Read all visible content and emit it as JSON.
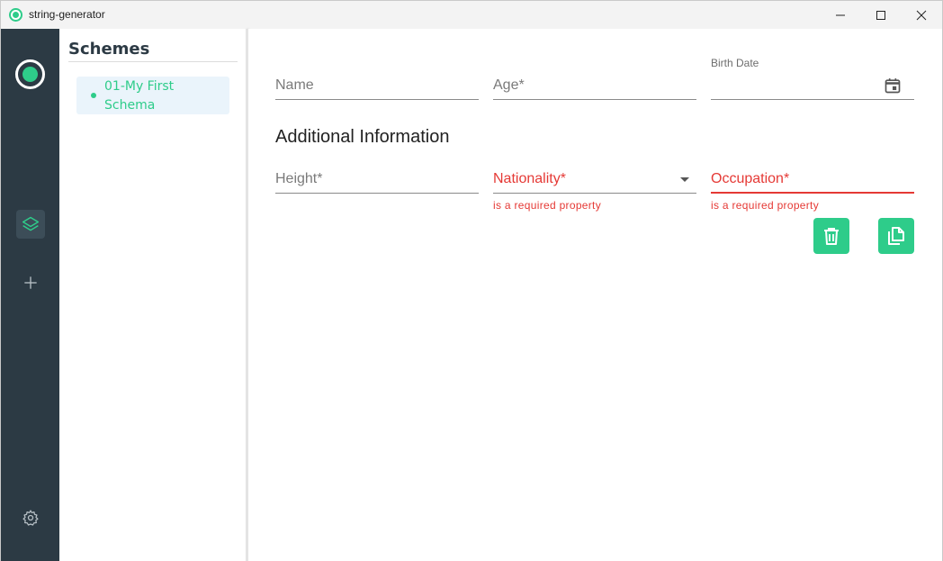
{
  "window": {
    "title": "string-generator"
  },
  "sidebar": {
    "title": "Schemes",
    "items": [
      {
        "label": "01-My First Schema",
        "selected": true
      }
    ]
  },
  "form": {
    "fields": {
      "name": {
        "placeholder": "Name",
        "value": ""
      },
      "age": {
        "placeholder": "Age*",
        "value": ""
      },
      "birth_date": {
        "label": "Birth Date",
        "value": ""
      }
    },
    "section_title": "Additional Information",
    "additional": {
      "height": {
        "placeholder": "Height*",
        "value": ""
      },
      "nationality": {
        "placeholder": "Nationality*",
        "value": "",
        "error": "is a required property"
      },
      "occupation": {
        "placeholder": "Occupation*",
        "value": "",
        "error": "is a required property"
      }
    }
  },
  "icons": {
    "app": "app-logo-icon",
    "layers": "layers-icon",
    "add": "plus-icon",
    "settings": "gear-icon",
    "calendar": "calendar-icon",
    "delete": "trash-icon",
    "copy": "copy-icon",
    "dropdown": "caret-down-icon"
  },
  "colors": {
    "accent": "#2ecc8a",
    "activity_bar": "#2c3a44",
    "error": "#e53935",
    "selected_bg": "#eaf4fb"
  }
}
